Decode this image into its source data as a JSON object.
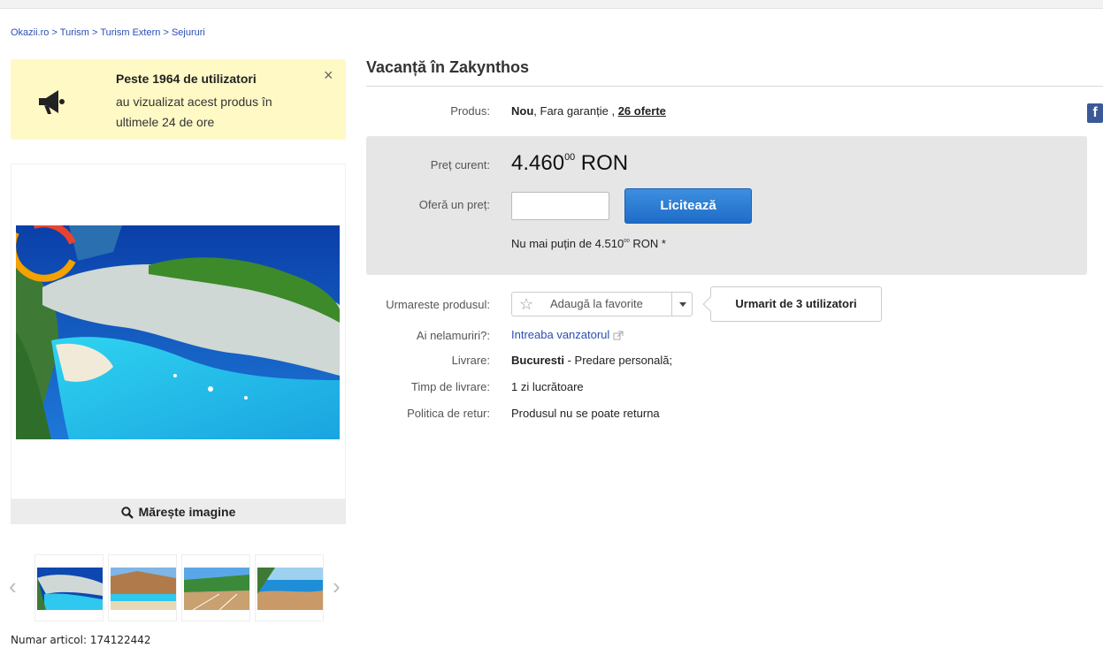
{
  "breadcrumb": {
    "items": [
      "Okazii.ro",
      "Turism",
      "Turism Extern",
      "Sejururi"
    ],
    "separator": ">"
  },
  "notice": {
    "title": "Peste 1964 de utilizatori",
    "body": "au vizualizat acest produs în ultimele 24 de ore",
    "close": "×",
    "icon": "megaphone-icon"
  },
  "gallery": {
    "zoom_label": "Mărește imagine",
    "prev": "‹",
    "next": "›"
  },
  "article_number": "Numar articol: 174122442",
  "product": {
    "title": "Vacanță în Zakynthos",
    "condition_label": "Produs:",
    "condition_new": "Nou",
    "condition_rest": ", Fara garanție ,",
    "offers_link": "26 oferte",
    "current_price_label": "Preț curent:",
    "current_price_main": "4.460",
    "current_price_cents": "00",
    "currency": "RON",
    "bid_label": "Oferă un preț:",
    "bid_value": "",
    "bid_button": "Licitează",
    "min_prefix": "Nu mai puțin de 4.510",
    "min_cents": "00",
    "min_suffix": "RON *",
    "follow_label": "Urmareste produsul:",
    "favorite_button": "Adaugă la favorite",
    "tracked_by": "Urmarit de 3 utilizatori",
    "questions_label": "Ai nelamuriri?:",
    "ask_seller_link": "Intreaba vanzatorul",
    "delivery_label": "Livrare:",
    "delivery_city": "Bucuresti",
    "delivery_rest": "- Predare personală;",
    "delivery_time_label": "Timp de livrare:",
    "delivery_time": "1 zi lucrătoare",
    "return_label": "Politica de retur:",
    "return_policy": "Produsul nu se poate returna"
  },
  "colors": {
    "link": "#2a4fb5",
    "notice_bg": "#fff9c6",
    "price_box_bg": "#e6e6e6",
    "bid_button": "#1f6cc7",
    "facebook": "#3b5998"
  },
  "social": {
    "facebook_icon": "f"
  }
}
